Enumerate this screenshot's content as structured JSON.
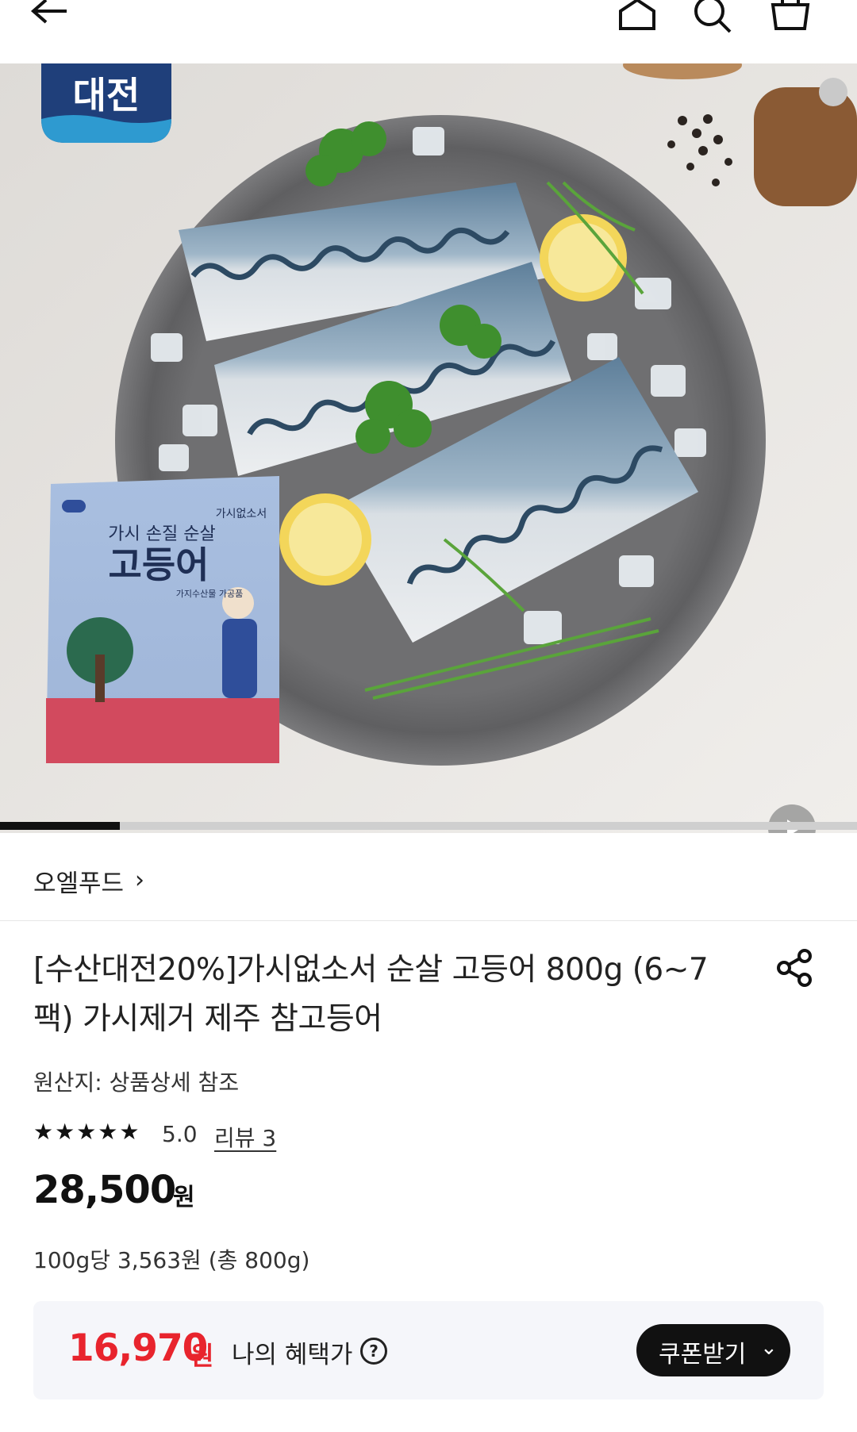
{
  "header": {
    "back_icon": "arrow-left-icon",
    "home_icon": "home-icon",
    "search_icon": "search-icon",
    "cart_icon": "cart-icon"
  },
  "gallery": {
    "badge_text": "대전",
    "package": {
      "brand": "가시없소서",
      "subtitle": "가시 손질 순살",
      "name": "고등어",
      "desc": "가지수산물 가공품"
    },
    "progress": 0.14,
    "play_icon": "play-icon"
  },
  "product": {
    "seller": "오엘푸드",
    "title": "[수산대전20%]가시없소서 순살 고등어 800g (6~7팩) 가시제거 제주 참고등어",
    "origin": "원산지: 상품상세 참조",
    "stars": "★★★★★",
    "rating": "5.0",
    "review_label": "리뷰 3",
    "price": "28,500",
    "price_unit": "원",
    "unit_price": "100g당 3,563원 (총 800g)"
  },
  "benefit": {
    "price": "16,970",
    "unit": "원",
    "label": "나의 혜택가",
    "help": "?",
    "coupon_label": "쿠폰받기"
  },
  "colors": {
    "accent_red": "#e8242d",
    "button_black": "#111111"
  }
}
